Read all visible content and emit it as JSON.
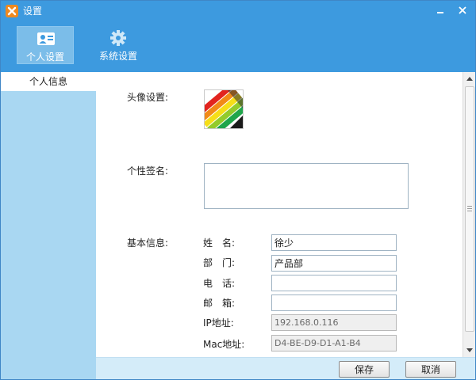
{
  "window": {
    "title": "设置",
    "icons": {
      "app": "app-logo-icon",
      "minimize": "minimize-icon",
      "close": "close-icon"
    }
  },
  "header": {
    "tabs": [
      {
        "label": "个人设置",
        "icon": "user-card-icon",
        "selected": true
      },
      {
        "label": "系统设置",
        "icon": "gear-icon",
        "selected": false
      }
    ]
  },
  "sidebar": {
    "items": [
      {
        "label": "个人信息",
        "selected": true
      }
    ]
  },
  "form": {
    "avatar": {
      "label": "头像设置:",
      "icon": "color-markers-avatar"
    },
    "signature": {
      "label": "个性签名:",
      "value": ""
    },
    "basic": {
      "label": "基本信息:",
      "fields": {
        "name": {
          "label": "姓　名:",
          "value": "徐少"
        },
        "department": {
          "label": "部　门:",
          "value": "产品部"
        },
        "phone": {
          "label": "电　话:",
          "value": ""
        },
        "email": {
          "label": "邮　箱:",
          "value": ""
        },
        "ip": {
          "label": "IP地址:",
          "value": "192.168.0.116"
        },
        "mac": {
          "label": "Mac地址:",
          "value": "D4-BE-D9-D1-A1-B4"
        }
      }
    }
  },
  "footer": {
    "save_label": "保存",
    "cancel_label": "取消"
  },
  "colors": {
    "titlebar": "#3d9adf",
    "sidebar": "#a9d7f2",
    "footer": "#d4ecf9",
    "tab_selected": "#7bbde9"
  }
}
